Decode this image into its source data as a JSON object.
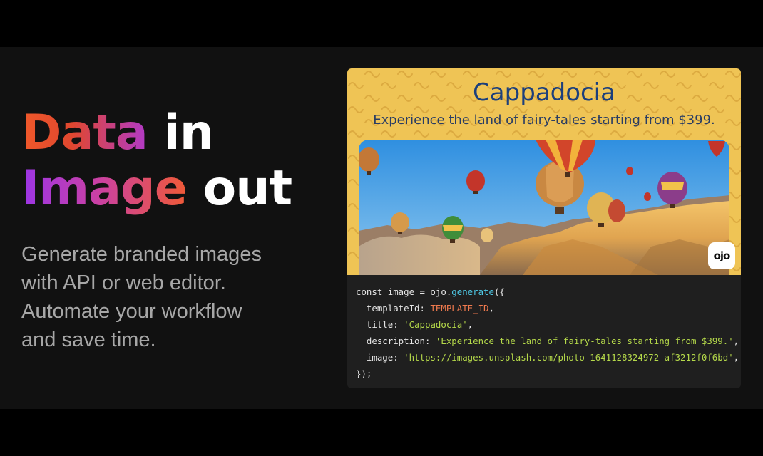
{
  "hero": {
    "headline": {
      "line1_grad": "Data",
      "line1_white": " in",
      "line2_grad": "Image",
      "line2_white": " out"
    },
    "subtitle_lines": [
      "Generate branded images",
      "with API or web editor.",
      "Automate your workflow",
      "and save time."
    ]
  },
  "preview": {
    "title": "Cappadocia",
    "description": "Experience the land of fairy-tales starting from $399.",
    "logo_text": "ojo",
    "background_color": "#efc455",
    "title_color": "#1c3f7c"
  },
  "code": {
    "l1_kw": "const image = ojo.",
    "l1_fn": "generate",
    "l1_end": "({",
    "l2_key": "  templateId: ",
    "l2_val": "TEMPLATE_ID",
    "l2_end": ",",
    "l3_key": "  title: ",
    "l3_val": "'Cappadocia'",
    "l3_end": ",",
    "l4_key": "  description: ",
    "l4_val": "'Experience the land of fairy-tales starting from $399.'",
    "l4_end": ",",
    "l5_key": "  image: ",
    "l5_val": "'https://images.unsplash.com/photo-1641128324972-af3212f0f6bd'",
    "l5_end": ",",
    "l6": "});"
  }
}
